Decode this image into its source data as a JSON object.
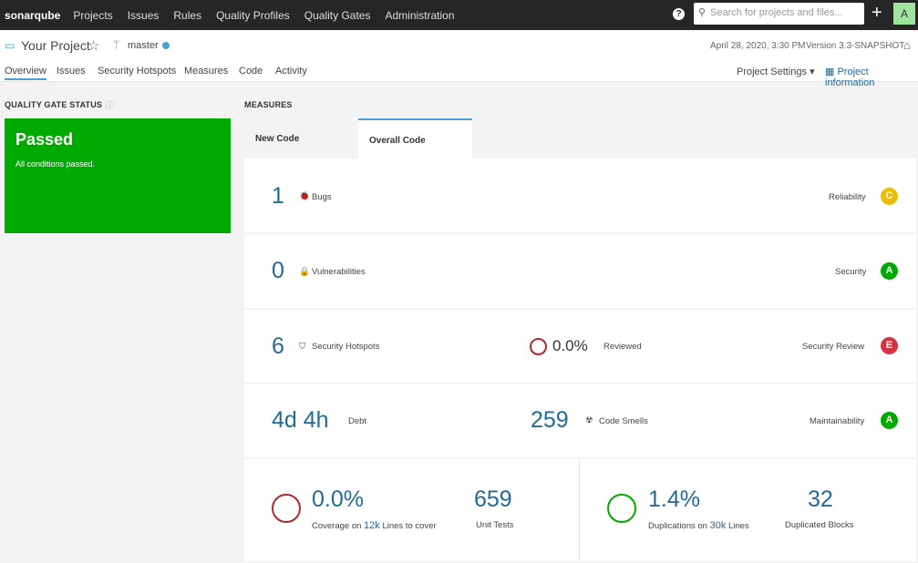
{
  "topbar": {
    "logo": "sonarqube",
    "nav": [
      "Projects",
      "Issues",
      "Rules",
      "Quality Profiles",
      "Quality Gates",
      "Administration"
    ],
    "search_placeholder": "Search for projects and files...",
    "avatar": "A"
  },
  "header": {
    "project": "Your Project",
    "branch": "master",
    "date": "April 28, 2020, 3:30 PM",
    "version": "Version 3.3-SNAPSHOT",
    "tabs": [
      "Overview",
      "Issues",
      "Security Hotspots",
      "Measures",
      "Code",
      "Activity"
    ],
    "settings": "Project Settings",
    "info": "Project information"
  },
  "quality_gate": {
    "title": "QUALITY GATE STATUS",
    "status": "Passed",
    "message": "All conditions passed.",
    "color": "#00aa00"
  },
  "measures": {
    "title": "MEASURES",
    "tabs": [
      "New Code",
      "Overall Code"
    ],
    "active_tab": "Overall Code",
    "bugs": {
      "value": "1",
      "label": "Bugs",
      "rating_label": "Reliability",
      "rating": "C",
      "color": "#eabe06"
    },
    "vulns": {
      "value": "0",
      "label": "Vulnerabilities",
      "rating_label": "Security",
      "rating": "A",
      "color": "#00aa00"
    },
    "hotspots": {
      "value": "6",
      "label": "Security Hotspots",
      "reviewed": "0.0%",
      "reviewed_label": "Reviewed",
      "rating_label": "Security Review",
      "rating": "E",
      "color": "#d4333f"
    },
    "debt": {
      "value": "4d 4h",
      "label": "Debt",
      "smells": "259",
      "smells_label": "Code Smells",
      "rating_label": "Maintainability",
      "rating": "A",
      "color": "#00aa00"
    },
    "coverage": {
      "value": "0.0%",
      "pre": "Coverage on",
      "lines": "12k",
      "post": "Lines to cover",
      "tests": "659",
      "tests_label": "Unit Tests"
    },
    "dup": {
      "value": "1.4%",
      "pre": "Duplications on",
      "lines": "30k",
      "post": "Lines",
      "blocks": "32",
      "blocks_label": "Duplicated Blocks"
    }
  }
}
